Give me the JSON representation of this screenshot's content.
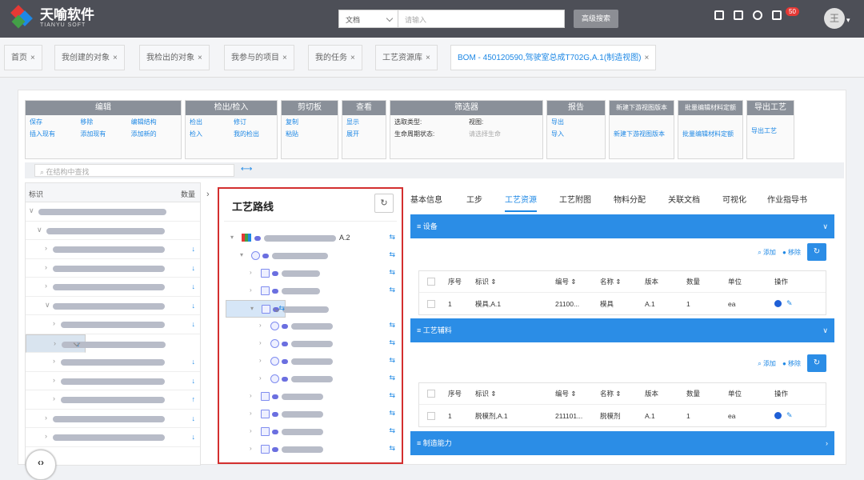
{
  "app": {
    "name": "天喻软件",
    "subname": "TIANYU SOFT"
  },
  "search": {
    "type_value": "文档",
    "placeholder": "请输入",
    "adv_label": "高级搜索"
  },
  "header": {
    "badge_count": "50",
    "avatar_text": "王"
  },
  "tabs": [
    {
      "label": "首页"
    },
    {
      "label": "我创建的对象"
    },
    {
      "label": "我检出的对象"
    },
    {
      "label": "我参与的项目"
    },
    {
      "label": "我的任务"
    },
    {
      "label": "工艺资源库"
    },
    {
      "label": "BOM - 450120590,驾驶室总成T702G,A.1(制造视图)"
    }
  ],
  "toolbar": {
    "groups": [
      {
        "title": "编辑",
        "items": [
          "保存",
          "移除",
          "编辑结构",
          "插入现有",
          "添加现有",
          "添加新的"
        ]
      },
      {
        "title": "检出/检入",
        "items": [
          "检出",
          "修订",
          "检入",
          "我的检出"
        ]
      },
      {
        "title": "剪切板",
        "items": [
          "复制",
          "粘贴"
        ]
      },
      {
        "title": "查看",
        "items": [
          "显示",
          "展开"
        ]
      },
      {
        "title": "筛选器",
        "items": [
          "选取类型:",
          "视图:",
          "生命周期状态:",
          "请选择生命"
        ]
      },
      {
        "title": "报告",
        "items": [
          "导出",
          "导入"
        ]
      },
      {
        "title": "新建下游视图版本",
        "items": [
          "新建下游视图版本"
        ]
      },
      {
        "title": "批量编辑材料定额",
        "items": [
          "批量编辑材料定额"
        ]
      },
      {
        "title": "导出工艺",
        "items": [
          "导出工艺"
        ]
      }
    ]
  },
  "struct_search": {
    "placeholder": "在结构中查找"
  },
  "left_table": {
    "col_id": "标识",
    "col_qty": "数量"
  },
  "process": {
    "title": "工艺路线",
    "root_suffix": "A.2"
  },
  "right_tabs": [
    "基本信息",
    "工步",
    "工艺资源",
    "工艺附图",
    "物料分配",
    "关联文档",
    "可视化",
    "作业指导书"
  ],
  "equipment": {
    "title": "设备",
    "add": "添加",
    "remove": "移除",
    "headers": [
      "序号",
      "标识 ⇕",
      "编号 ⇕",
      "名称 ⇕",
      "版本",
      "数量",
      "单位",
      "操作"
    ],
    "rows": [
      {
        "seq": "1",
        "id": "模具,A.1",
        "num": "21100...",
        "name": "模具",
        "ver": "A.1",
        "qty": "1",
        "unit": "ea"
      }
    ]
  },
  "materials": {
    "title": "工艺辅料",
    "add": "添加",
    "remove": "移除",
    "headers": [
      "序号",
      "标识 ⇕",
      "编号 ⇕",
      "名称 ⇕",
      "版本",
      "数量",
      "单位",
      "操作"
    ],
    "rows": [
      {
        "seq": "1",
        "id": "脱模剂,A.1",
        "num": "211101...",
        "name": "脱模剂",
        "ver": "A.1",
        "qty": "1",
        "unit": "ea"
      }
    ]
  },
  "capability": {
    "title": "制造能力"
  }
}
